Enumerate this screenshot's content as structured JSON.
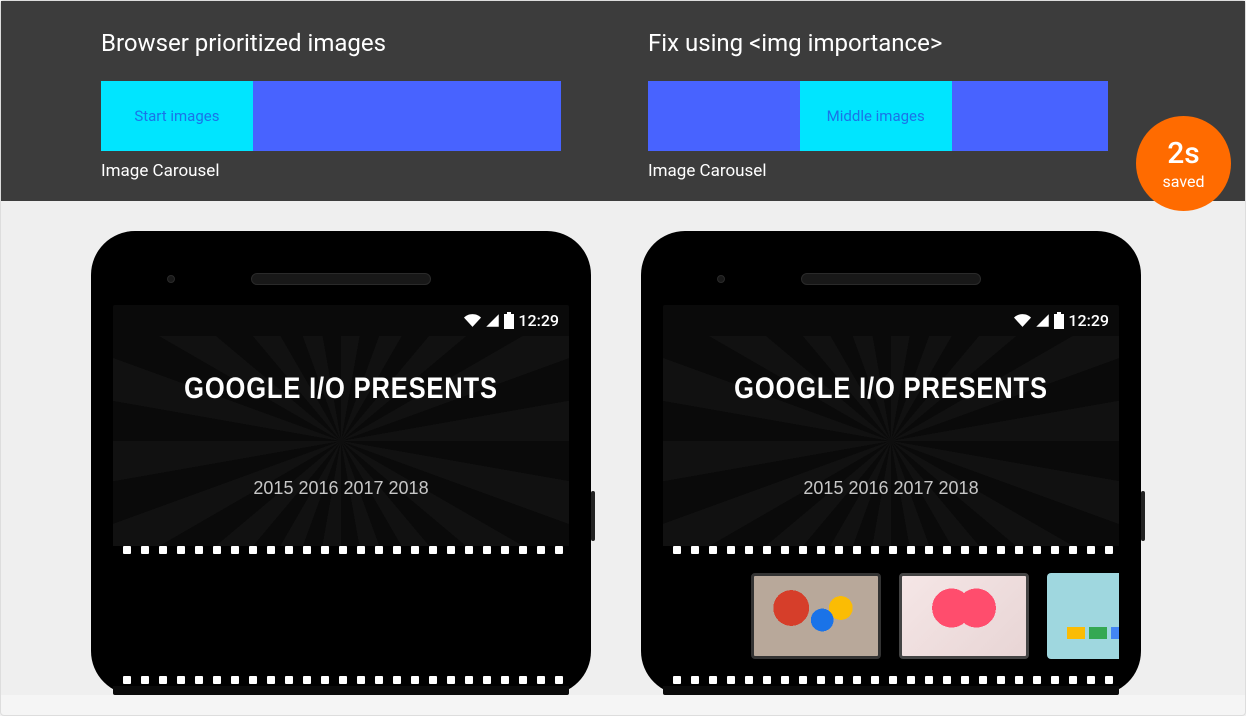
{
  "header": {
    "left": {
      "title": "Browser prioritized images",
      "bar": {
        "highlight_label": "Start images",
        "highlight_position": "start"
      },
      "caption": "Image Carousel"
    },
    "right": {
      "title": "Fix using <img importance>",
      "bar": {
        "highlight_label": "Middle images",
        "highlight_position": "middle"
      },
      "caption": "Image Carousel"
    },
    "badge": {
      "main": "2s",
      "sub": "saved"
    }
  },
  "phones": {
    "status_time": "12:29",
    "title_line": "GOOGLE I/O PRESENTS",
    "years": "2015 2016 2017 2018",
    "left": {
      "images_loaded": false
    },
    "right": {
      "images_loaded": true
    }
  },
  "colors": {
    "highlight_cyan": "#00e5ff",
    "bar_blue": "#4863ff",
    "badge_bg": "#ff6b00",
    "header_bg": "#3c3c3c"
  }
}
